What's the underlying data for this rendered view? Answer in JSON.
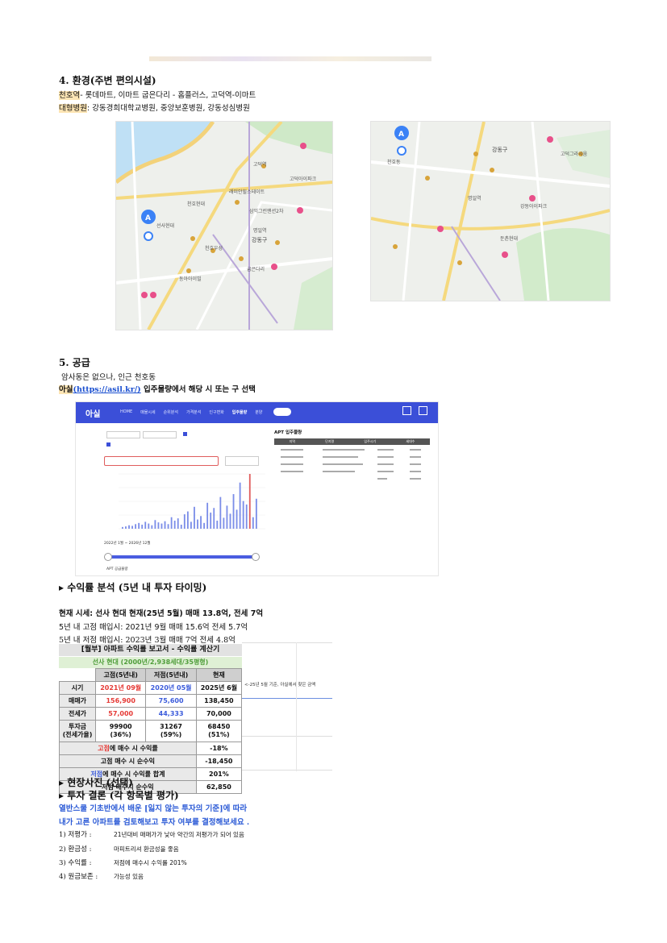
{
  "sec4": {
    "title": "4. 환경(주변 편의시설)",
    "line1_label": "천호역",
    "line1_text": "- 롯데마트, 이마트   굽은다리 - 홈플러스, 고덕역-이마트",
    "line2_label": "대형병원",
    "line2_text": ": 강동경희대학교병원, 중앙보훈병원, 강동성심병원"
  },
  "map1": {
    "labels": [
      "고덕역",
      "고덕아이파크",
      "래미안힐스테이트",
      "명일역",
      "강동구",
      "굽은다리",
      "천호현대",
      "선사현대",
      "동아아이빌",
      "천호우성",
      "삼익그린맨션2차"
    ]
  },
  "map2": {
    "labels": [
      "천호동",
      "강동구",
      "명일역",
      "고덕그라시움",
      "둔촌현대",
      "강동아이파크"
    ]
  },
  "sec5": {
    "title": "5. 공급",
    "line1": "암사동은 없으나, 인근 천호동",
    "asil_label": "아실",
    "asil_link": "(https://asil.kr/)",
    "asil_rest": " 입주물량에서 해당 시 또는 구 선택"
  },
  "asil": {
    "brand": "아실",
    "nav": [
      "HOME",
      "매물시세",
      "순위분석",
      "가격분석",
      "인구변화",
      "입주물량",
      "분양"
    ],
    "panel_title": "APT 입주물량",
    "columns": [
      "지역",
      "단지명",
      "입주시기",
      "세대수"
    ],
    "slider_label": "2022년 1월 ~ 2026년 12월",
    "footer": "APT 공급물량",
    "bars": [
      3,
      4,
      6,
      5,
      8,
      10,
      7,
      12,
      9,
      6,
      15,
      11,
      9,
      13,
      8,
      20,
      14,
      18,
      7,
      25,
      30,
      12,
      38,
      16,
      22,
      10,
      45,
      28,
      36,
      14,
      55,
      19,
      40,
      26,
      60,
      33,
      80,
      48,
      42,
      95,
      20,
      52
    ]
  },
  "sec_roi": {
    "title": "▸ 수익률 분석 (5년 내 투자 타이밍)",
    "line1": "현재 시세: 선사 현대 현재(25년 5월) 매매 13.8억, 전세 7억",
    "line2": "5년 내 고점 매입시: 2021년 9월 매매 15.6억 전세 5.7억",
    "line3": "5년 내 저점 매입시: 2023년 3월 매매 7억 전세 4.8억"
  },
  "calc": {
    "title": "[월부] 아파트 수익률 보고서 - 수익률 계산기",
    "subtitle": "선사 현대 (2000년/2,938세대/35평형)",
    "head": [
      "고점(5년내)",
      "저점(5년내)",
      "현재"
    ],
    "note": "<-25년 5월 기준, 아실에서 찾은 금액",
    "rows": [
      {
        "label": "시기",
        "a": "2021년 09월",
        "b": "2020년 05월",
        "c": "2025년 6월"
      },
      {
        "label": "매매가",
        "a": "156,900",
        "b": "75,600",
        "c": "138,450"
      },
      {
        "label": "전세가",
        "a": "57,000",
        "b": "44,333",
        "c": "70,000"
      },
      {
        "label": "투자금\n(전세가율)",
        "a": "99900\n(36%)",
        "b": "31267\n(59%)",
        "c": "68450\n(51%)"
      }
    ],
    "summary": [
      {
        "pre": "고점",
        "rest": "에 매수 시 수익률",
        "value": "-18%"
      },
      {
        "pre": "",
        "rest": "고점 매수 시 순수익",
        "value": "-18,450"
      },
      {
        "pre": "저점",
        "rest": "에 매수 시 수익률 합계",
        "value": "201%"
      },
      {
        "pre": "",
        "rest": "저점 매수시 순수익",
        "value": "62,850"
      }
    ]
  },
  "sec_photo": {
    "title": "▸ 현장사진 (선택)"
  },
  "sec_conc": {
    "title": "▸ 투자 결론 (각 항목별 평가)",
    "intro1": "열반스쿨 기초반에서 배운 [잃지 않는 투자의 기준]에 따라",
    "intro2": "내가 고른 아파트를 검토해보고 투자 여부를 결정해보세요 .",
    "items": [
      {
        "label": "1) 저평가 :",
        "value": "21년대비 매매가가 낮아 약간의 저평가가 되어 있음"
      },
      {
        "label": "2) 환금성 :",
        "value": "마피트리셔 환금성을 좋음"
      },
      {
        "label": "3) 수익률 :",
        "value": "저점에 매수시 수익률 201%"
      },
      {
        "label": "4) 원금보존 :",
        "value": "가능성 있음"
      }
    ]
  },
  "colors": {
    "highlight": "#fde5b4",
    "asil_blue": "#3b4fd8",
    "red": "#e53935",
    "blue": "#3b5bdb"
  }
}
